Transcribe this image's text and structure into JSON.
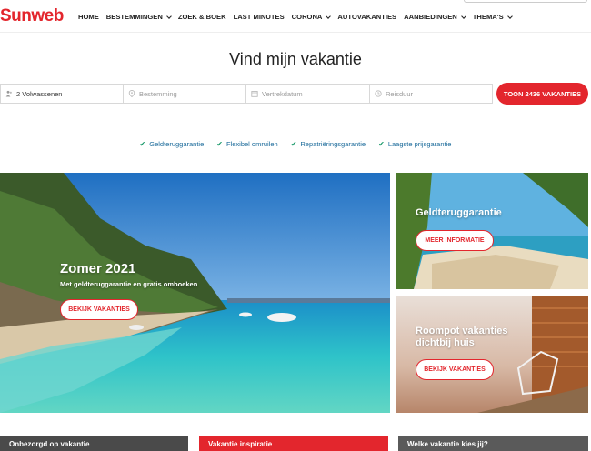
{
  "header": {
    "logo": "Sunweb",
    "nav": [
      {
        "label": "HOME",
        "dropdown": false
      },
      {
        "label": "BESTEMMINGEN",
        "dropdown": true
      },
      {
        "label": "ZOEK & BOEK",
        "dropdown": false
      },
      {
        "label": "LAST MINUTES",
        "dropdown": false
      },
      {
        "label": "CORONA",
        "dropdown": true
      },
      {
        "label": "AUTOVAKANTIES",
        "dropdown": false
      },
      {
        "label": "AANBIEDINGEN",
        "dropdown": true
      },
      {
        "label": "THEMA'S",
        "dropdown": true
      }
    ]
  },
  "title": "Vind mijn vakantie",
  "search": {
    "travellers": "2 Volwassenen",
    "destination_placeholder": "Bestemming",
    "departure_placeholder": "Vertrekdatum",
    "duration_placeholder": "Reisduur",
    "button": "TOON 2436 VAKANTIES"
  },
  "usps": [
    "Geldteruggarantie",
    "Flexibel omruilen",
    "Repatriëringsgarantie",
    "Laagste prijsgarantie"
  ],
  "hero": {
    "title": "Zomer 2021",
    "subtitle": "Met geldteruggarantie en gratis omboeken",
    "button": "BEKIJK VAKANTIES"
  },
  "tiles": [
    {
      "title": "Geldteruggarantie",
      "button": "MEER INFORMATIE"
    },
    {
      "title_line1": "Roompot vakanties",
      "title_line2": "dichtbij huis",
      "button": "BEKIJK VAKANTIES"
    }
  ],
  "bottom_cards": [
    "Onbezorgd op vakantie",
    "Vakantie inspiratie",
    "Welke vakantie kies jij?"
  ],
  "colors": {
    "brand": "#e3262d",
    "usp_text": "#1a6a9a",
    "check": "#1b9a6b"
  }
}
